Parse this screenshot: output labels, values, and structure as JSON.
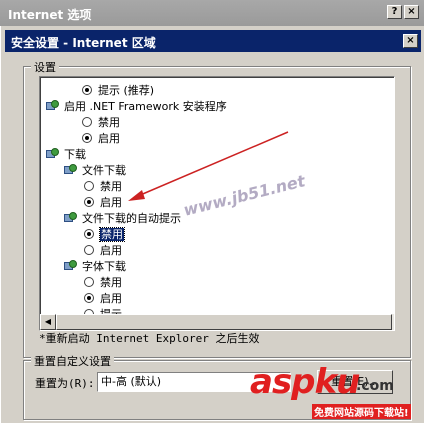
{
  "background_window": {
    "title": "Internet 选项",
    "help_button": "?",
    "close_button": "×"
  },
  "dialog": {
    "title": "安全设置 - Internet 区域",
    "close_button": "×",
    "settings_group": "设置",
    "items": [
      {
        "type": "radio",
        "label": "提示 (推荐)",
        "checked": true,
        "indent": 2
      },
      {
        "type": "header",
        "label": "启用 .NET Framework 安装程序",
        "indent": 0
      },
      {
        "type": "radio",
        "label": "禁用",
        "checked": false,
        "indent": 2
      },
      {
        "type": "radio",
        "label": "启用",
        "checked": true,
        "indent": 2
      },
      {
        "type": "header",
        "label": "下载",
        "indent": 0
      },
      {
        "type": "header",
        "label": "文件下载",
        "indent": 1
      },
      {
        "type": "radio",
        "label": "禁用",
        "checked": false,
        "indent": 3
      },
      {
        "type": "radio",
        "label": "启用",
        "checked": true,
        "indent": 3
      },
      {
        "type": "header",
        "label": "文件下载的自动提示",
        "indent": 1
      },
      {
        "type": "radio",
        "label": "禁用",
        "checked": true,
        "indent": 3,
        "selected": true
      },
      {
        "type": "radio",
        "label": "启用",
        "checked": false,
        "indent": 3
      },
      {
        "type": "header",
        "label": "字体下载",
        "indent": 1
      },
      {
        "type": "radio",
        "label": "禁用",
        "checked": false,
        "indent": 3
      },
      {
        "type": "radio",
        "label": "启用",
        "checked": true,
        "indent": 3
      },
      {
        "type": "radio",
        "label": "提示",
        "checked": false,
        "indent": 3
      }
    ],
    "note": "*重新启动 Internet Explorer 之后生效",
    "reset_group": "重置自定义设置",
    "reset_label": "重置为(R):",
    "reset_value": "中-高 (默认)",
    "reset_button": "重置(E)..."
  },
  "watermarks": {
    "jb51": "www.jb51.net",
    "aspku": "aspku",
    "aspku_com": ".com",
    "aspku_sub": "免费网站源码下载站!"
  },
  "colors": {
    "titlebar": "#0a246a",
    "arrow": "#cc2222",
    "watermark_red": "#e02020"
  }
}
